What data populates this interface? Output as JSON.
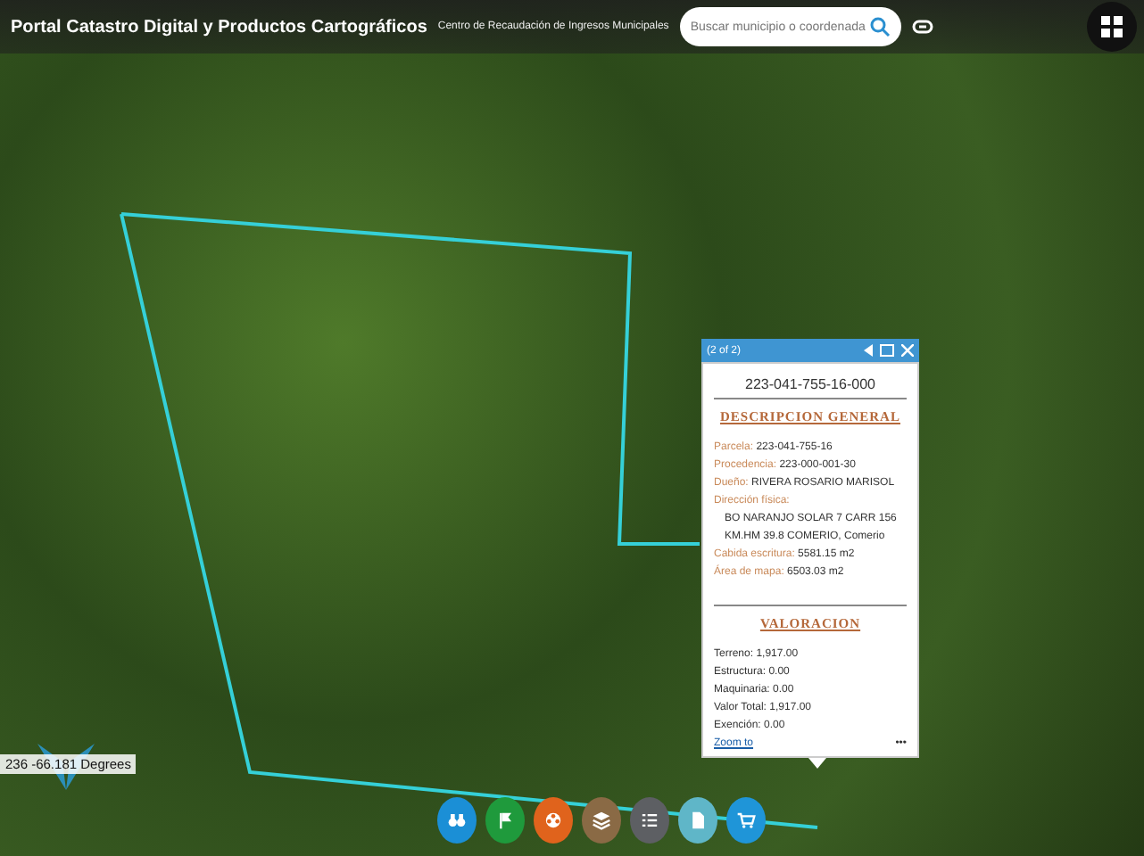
{
  "header": {
    "title": "Portal Catastro Digital y Productos Cartográficos",
    "agency": "Centro de Recaudación de Ingresos Municipales",
    "search": {
      "placeholder": "Buscar municipio o coordenada"
    }
  },
  "popup": {
    "pager": "(2 of 2)",
    "parcel_id": "223-041-755-16-000",
    "sections": [
      {
        "heading": "DESCRIPCION GENERAL",
        "kind": "labeled",
        "fields": [
          {
            "label": "Parcela:",
            "value": "223-041-755-16"
          },
          {
            "label": "Procedencia:",
            "value": "223-000-001-30"
          },
          {
            "label": "Dueño:",
            "value": "RIVERA ROSARIO MARISOL"
          },
          {
            "label": "Dirección física:",
            "value": "BO NARANJO SOLAR 7 CARR 156 KM.HM 39.8 COMERIO, Comerio",
            "block": true
          },
          {
            "label": "Cabida escritura:",
            "value": "5581.15 m2"
          },
          {
            "label": "Área de mapa:",
            "value": "6503.03 m2"
          }
        ]
      },
      {
        "heading": "VALORACION",
        "kind": "plain",
        "fields": [
          {
            "label": "Terreno:",
            "value": "1,917.00"
          },
          {
            "label": "Estructura:",
            "value": "0.00"
          },
          {
            "label": "Maquinaria:",
            "value": "0.00"
          },
          {
            "label": "Valor Total:",
            "value": "1,917.00"
          },
          {
            "label": "Exención:",
            "value": "0.00"
          }
        ]
      }
    ],
    "zoom_link": "Zoom to",
    "more": "•••"
  },
  "coordinates": "236 -66.181 Degrees",
  "toolbar": [
    {
      "kind": "binoculars",
      "color": "#1b8fd6"
    },
    {
      "kind": "flag",
      "color": "#1f9a3c"
    },
    {
      "kind": "film",
      "color": "#e0631c"
    },
    {
      "kind": "layers",
      "color": "#8a6a45"
    },
    {
      "kind": "list",
      "color": "#5d5f63"
    },
    {
      "kind": "document",
      "color": "#5fb6c8"
    },
    {
      "kind": "cart",
      "color": "#1f95d8"
    }
  ]
}
